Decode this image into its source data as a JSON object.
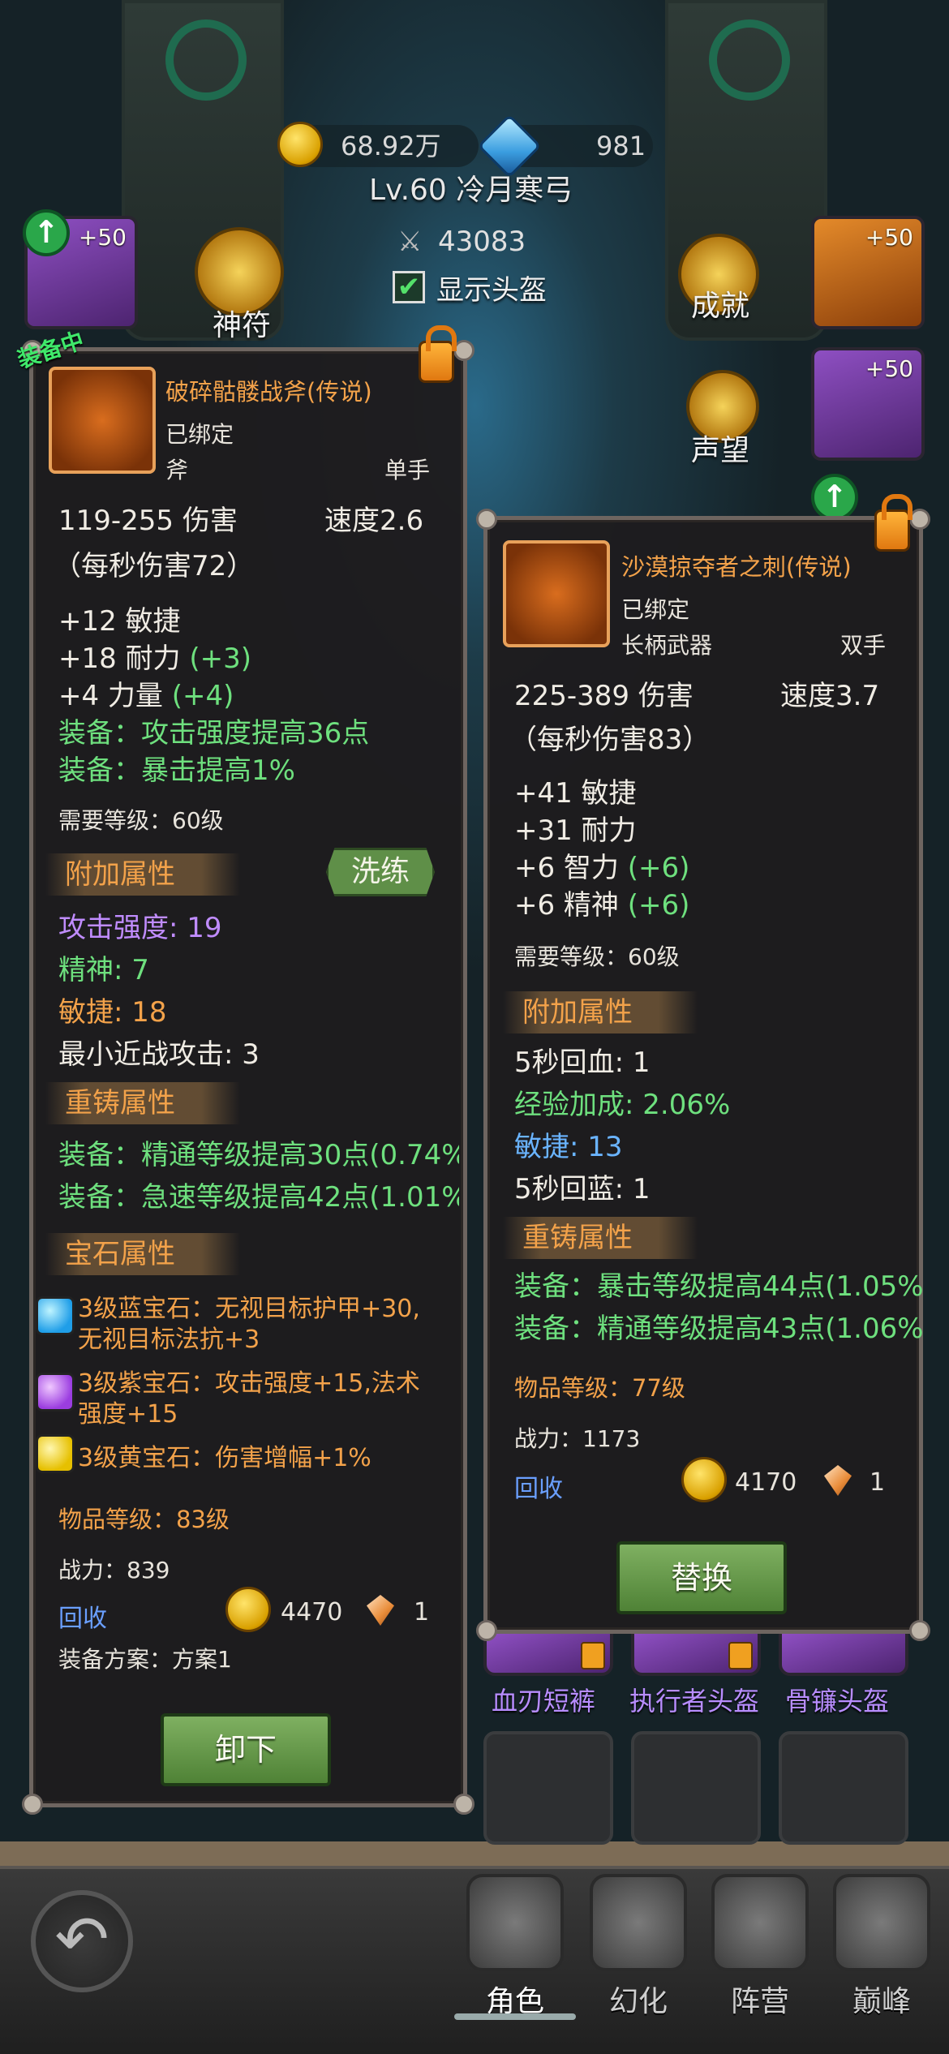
{
  "resources": {
    "gold": "68.92万",
    "gems": "981"
  },
  "player": {
    "level_name": "Lv.60 冷月寒弓",
    "power": "43083",
    "show_helmet_label": "显示头盔",
    "show_helmet_checked": true
  },
  "side": {
    "rune_label": "神符",
    "achievement_label": "成就",
    "reputation_label": "声望",
    "plus50": "+50"
  },
  "bottom_slots": {
    "labels": [
      "血刃短裤",
      "执行者头盔",
      "骨镰头盔"
    ]
  },
  "nav": {
    "items": [
      "角色",
      "幻化",
      "阵营",
      "巅峰"
    ],
    "active": "角色"
  },
  "left_panel": {
    "equipped_tag": "装备中",
    "name": "破碎骷髅战斧(传说)",
    "bound": "已绑定",
    "type": "斧",
    "hand": "单手",
    "damage": "119-255 伤害",
    "speed": "速度2.6",
    "dps": "（每秒伤害72）",
    "stats": [
      "+12 敏捷",
      "+18 耐力",
      "+4 力量"
    ],
    "stat_bonus": [
      "",
      "(+3)",
      "(+4)"
    ],
    "equip_effects": [
      "装备：攻击强度提高36点",
      "装备：暴击提高1%"
    ],
    "required_level": "需要等级：60级",
    "extra_head": "附加属性",
    "refine_label": "洗练",
    "extra_stats": [
      "攻击强度: 19",
      "精神: 7",
      "敏捷: 18",
      "最小近战攻击: 3"
    ],
    "reforge_head": "重铸属性",
    "reforge_stats": [
      "装备：精通等级提高30点(0.74%",
      "装备：急速等级提高42点(1.01%"
    ],
    "gem_head": "宝石属性",
    "gems": [
      "3级蓝宝石：无视目标护甲+30,",
      "无视目标法抗+3",
      "3级紫宝石：攻击强度+15,法术",
      "强度+15",
      "3级黄宝石：伤害增幅+1%"
    ],
    "item_level": "物品等级：83级",
    "power": "战力：839",
    "recycle": "回收",
    "recycle_gold": "4470",
    "recycle_gem": "1",
    "plan": "装备方案：方案1",
    "button": "卸下"
  },
  "right_panel": {
    "name": "沙漠掠夺者之刺(传说)",
    "bound": "已绑定",
    "type": "长柄武器",
    "hand": "双手",
    "damage": "225-389 伤害",
    "speed": "速度3.7",
    "dps": "（每秒伤害83）",
    "stats": [
      "+41 敏捷",
      "+31 耐力",
      "+6 智力",
      "+6 精神"
    ],
    "stat_bonus": [
      "",
      "",
      "(+6)",
      "(+6)"
    ],
    "required_level": "需要等级：60级",
    "extra_head": "附加属性",
    "extra_stats": [
      "5秒回血: 1",
      "经验加成: 2.06%",
      "敏捷: 13",
      "5秒回蓝: 1"
    ],
    "reforge_head": "重铸属性",
    "reforge_stats": [
      "装备：暴击等级提高44点(1.05%",
      "装备：精通等级提高43点(1.06%"
    ],
    "item_level": "物品等级：77级",
    "power": "战力：1173",
    "recycle": "回收",
    "recycle_gold": "4170",
    "recycle_gem": "1",
    "button": "替换"
  }
}
